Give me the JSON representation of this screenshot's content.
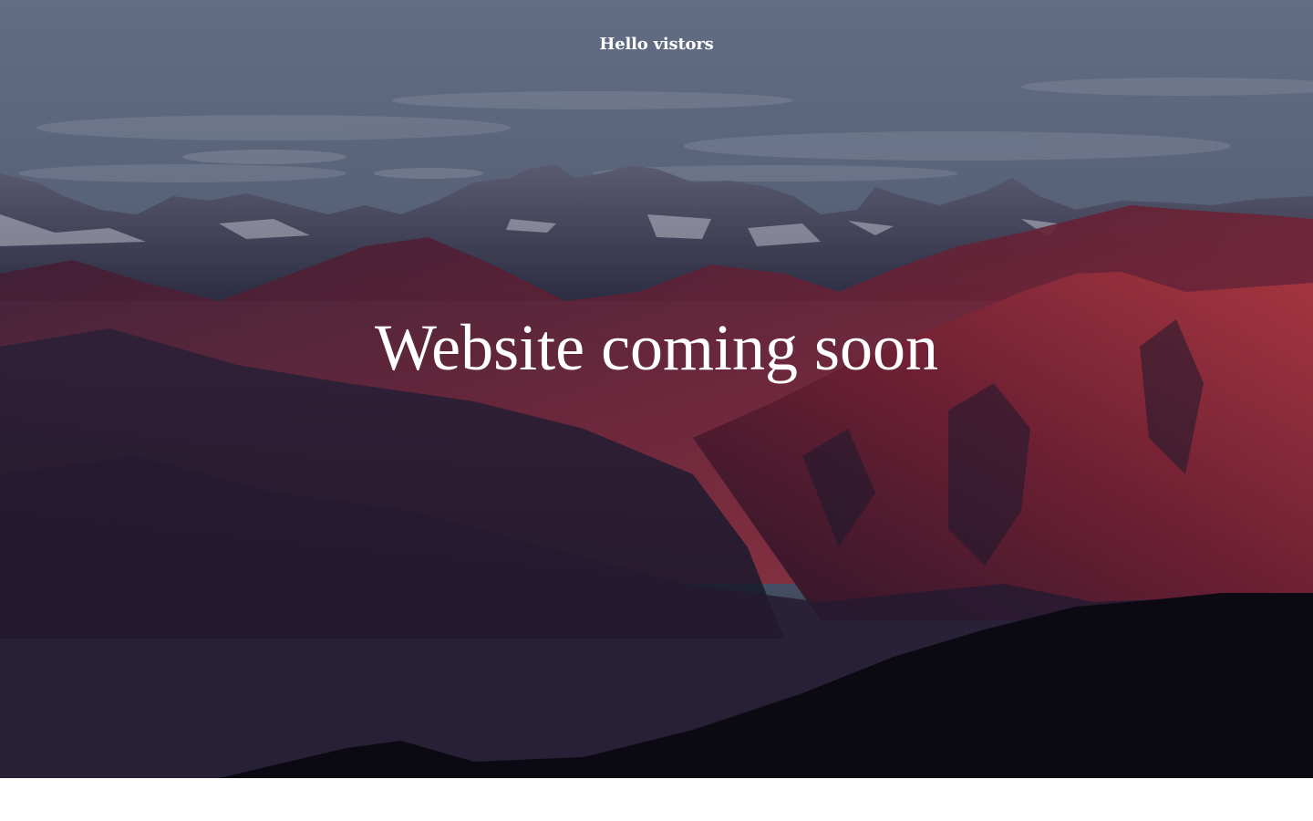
{
  "hero": {
    "greeting": "Hello vistors",
    "headline": "Website coming soon"
  },
  "colors": {
    "sky": "#4d576c",
    "mountain_red": "#8a2a3e",
    "shadow": "#111222",
    "text": "#ffffff"
  }
}
